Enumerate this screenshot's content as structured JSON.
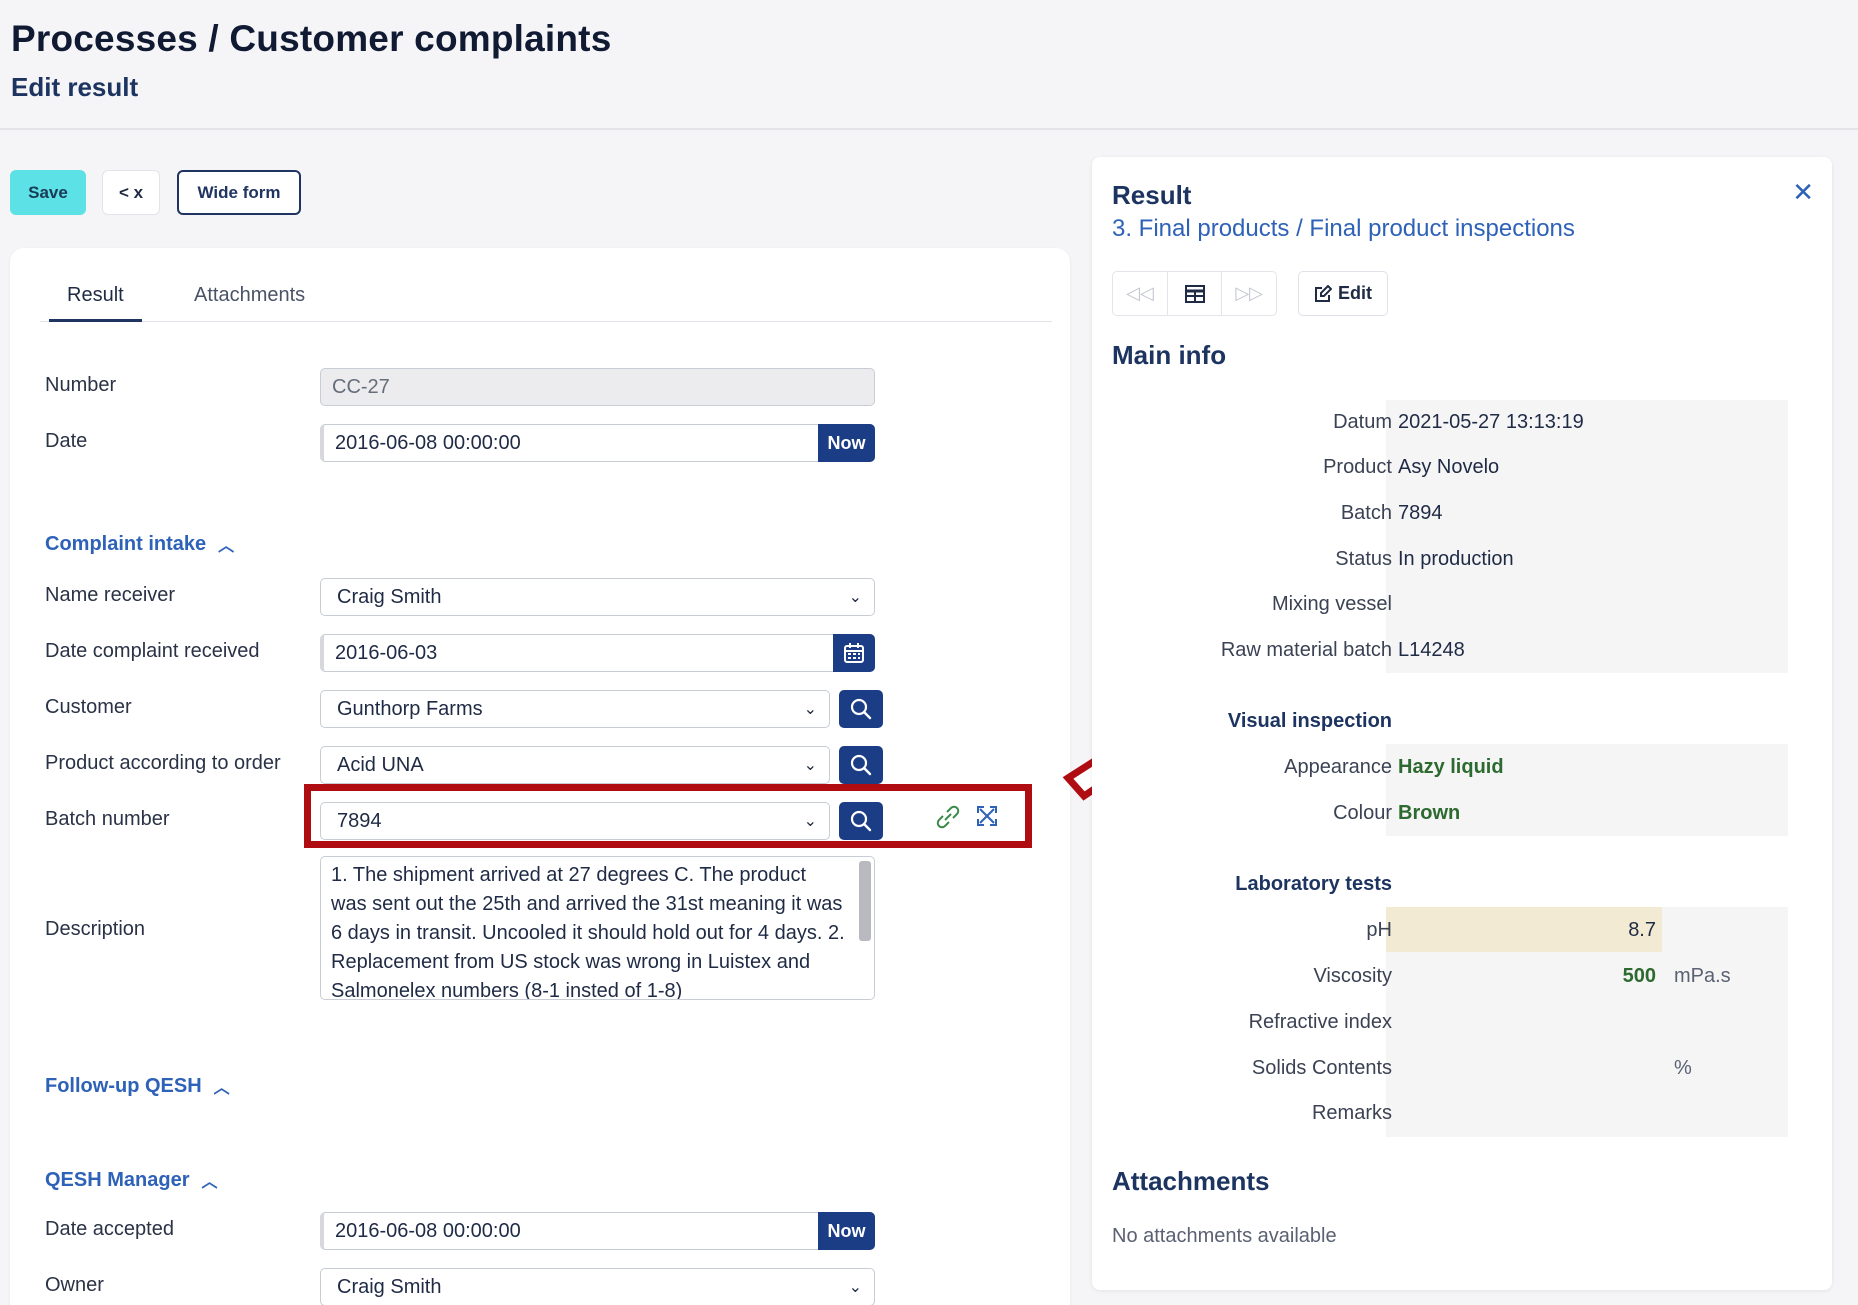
{
  "header": {
    "title": "Processes / Customer complaints",
    "subtitle": "Edit result"
  },
  "toolbar": {
    "save_label": "Save",
    "back_label": "< x",
    "wide_label": "Wide form"
  },
  "tabs": [
    {
      "label": "Result",
      "active": true
    },
    {
      "label": "Attachments",
      "active": false
    }
  ],
  "form": {
    "number": {
      "label": "Number",
      "value": "CC-27"
    },
    "date": {
      "label": "Date",
      "value": "2016-06-08 00:00:00",
      "button": "Now"
    },
    "complaint_intake": {
      "heading": "Complaint intake",
      "name_receiver": {
        "label": "Name receiver",
        "value": "Craig Smith"
      },
      "date_received": {
        "label": "Date complaint received",
        "value": "2016-06-03"
      },
      "customer": {
        "label": "Customer",
        "value": "Gunthorp Farms"
      },
      "product": {
        "label": "Product according to order",
        "value": "Acid UNA"
      },
      "batch": {
        "label": "Batch number",
        "value": "7894"
      },
      "description": {
        "label": "Description",
        "value": "1. The shipment arrived at 27 degrees C. The product was sent out the 25th and arrived the 31st meaning it was 6 days in transit. Uncooled it should hold out for 4 days.  2. Replacement from US stock was wrong in Luistex and Salmonelex numbers (8-1 insted of 1-8)"
      }
    },
    "followup": {
      "heading": "Follow-up QESH"
    },
    "qesh_manager": {
      "heading": "QESH Manager",
      "date_accepted": {
        "label": "Date accepted",
        "value": "2016-06-08 00:00:00",
        "button": "Now"
      },
      "owner": {
        "label": "Owner",
        "value": "Craig Smith"
      }
    }
  },
  "panel": {
    "title": "Result",
    "link": "3. Final products / Final product inspections",
    "edit_label": "Edit",
    "main_info": {
      "heading": "Main info",
      "rows": [
        {
          "label": "Datum",
          "value": "2021-05-27 13:13:19"
        },
        {
          "label": "Product",
          "value": "Asy Novelo"
        },
        {
          "label": "Batch",
          "value": "7894"
        },
        {
          "label": "Status",
          "value": "In production"
        },
        {
          "label": "Mixing vessel",
          "value": ""
        },
        {
          "label": "Raw material batch",
          "value": "L14248"
        }
      ]
    },
    "visual_inspection": {
      "heading": "Visual inspection",
      "rows": [
        {
          "label": "Appearance",
          "value": "Hazy liquid"
        },
        {
          "label": "Colour",
          "value": "Brown"
        }
      ]
    },
    "laboratory_tests": {
      "heading": "Laboratory tests",
      "rows": [
        {
          "label": "pH",
          "value": "8.7",
          "unit": ""
        },
        {
          "label": "Viscosity",
          "value": "500",
          "unit": "mPa.s"
        },
        {
          "label": "Refractive index",
          "value": "",
          "unit": ""
        },
        {
          "label": "Solids Contents",
          "value": "",
          "unit": "%"
        },
        {
          "label": "Remarks",
          "value": "",
          "unit": ""
        }
      ]
    },
    "attachments": {
      "heading": "Attachments",
      "empty_text": "No attachments available"
    }
  },
  "colors": {
    "save": "#5ce1e6",
    "primary": "#1b3d86",
    "highlight": "#b00d12",
    "link": "#2e62b8"
  }
}
